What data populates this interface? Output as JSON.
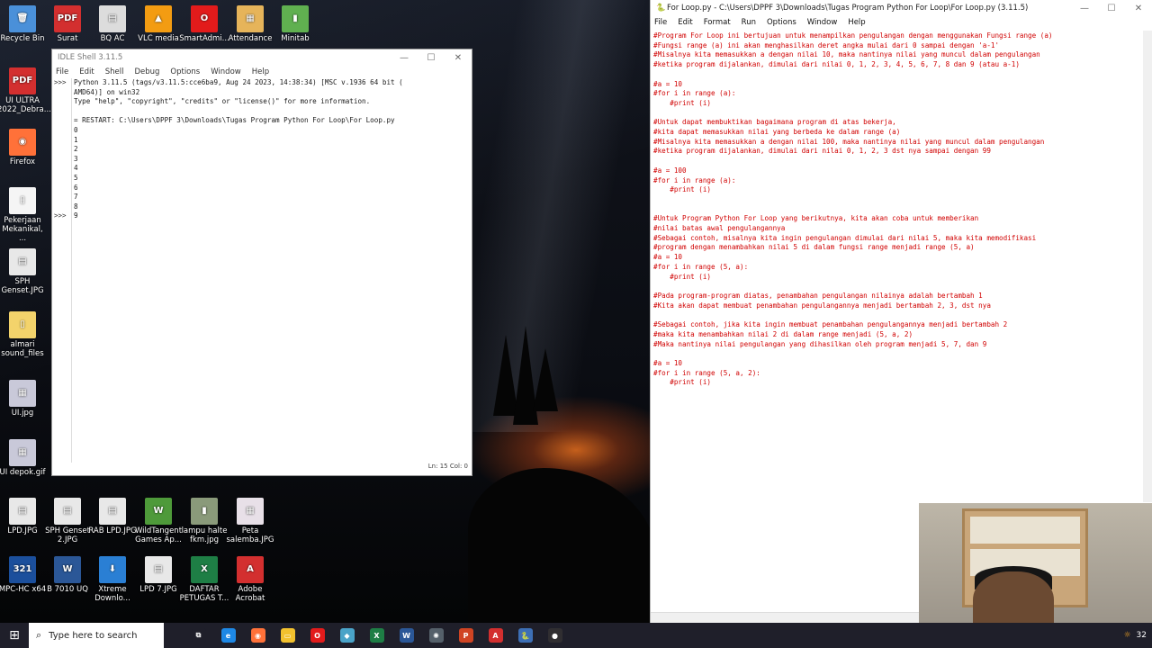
{
  "desktop": {
    "icons": [
      {
        "label": "Recycle Bin",
        "glyph": "🗑",
        "color": "#4a90d9"
      },
      {
        "label": "Surat",
        "glyph": "PDF",
        "color": "#d32f2f"
      },
      {
        "label": "BQ AC",
        "glyph": "▤",
        "color": "#dcdcdc"
      },
      {
        "label": "VLC media",
        "glyph": "▲",
        "color": "#f39c12"
      },
      {
        "label": "SmartAdmi...",
        "glyph": "O",
        "color": "#e21b1b"
      },
      {
        "label": "Attendance",
        "glyph": "▦",
        "color": "#e6b45a"
      },
      {
        "label": "Minitab",
        "glyph": "▮",
        "color": "#60b050"
      },
      {
        "label": "UI ULTRA 2022_Debra...",
        "glyph": "PDF",
        "color": "#d32f2f"
      },
      {
        "label": "Firefox",
        "glyph": "◉",
        "color": "#ff7139"
      },
      {
        "label": "Pekerjaan Mekanikal, ...",
        "glyph": "▯",
        "color": "#f5f5f5"
      },
      {
        "label": "SPH Genset.JPG",
        "glyph": "▤",
        "color": "#e8e8e8"
      },
      {
        "label": "almari sound_files",
        "glyph": "▯",
        "color": "#f3d36b"
      },
      {
        "label": "UI.jpg",
        "glyph": "▦",
        "color": "#c9c9d9"
      },
      {
        "label": "UI depok.gif",
        "glyph": "▦",
        "color": "#c9c9d9"
      },
      {
        "label": "LPD.JPG",
        "glyph": "▤",
        "color": "#e8e8e8"
      },
      {
        "label": "SPH Genset 2.JPG",
        "glyph": "▤",
        "color": "#e8e8e8"
      },
      {
        "label": "RAB LPD.JPG",
        "glyph": "▤",
        "color": "#e8e8e8"
      },
      {
        "label": "WildTangent Games Ap...",
        "glyph": "W",
        "color": "#4e9a3a"
      },
      {
        "label": "lampu halte fkm.jpg",
        "glyph": "▮",
        "color": "#8a9a7a"
      },
      {
        "label": "Peta salemba.JPG",
        "glyph": "▦",
        "color": "#e8e0e8"
      },
      {
        "label": "MPC-HC x64",
        "glyph": "321",
        "color": "#1b4f9c"
      },
      {
        "label": "B 7010 UQ",
        "glyph": "W",
        "color": "#2b5797"
      },
      {
        "label": "Xtreme Downlo...",
        "glyph": "⬇",
        "color": "#2a7fd4"
      },
      {
        "label": "LPD 7.JPG",
        "glyph": "▤",
        "color": "#e8e8e8"
      },
      {
        "label": "DAFTAR PETUGAS T...",
        "glyph": "X",
        "color": "#1e7e45"
      },
      {
        "label": "Adobe Acrobat",
        "glyph": "A",
        "color": "#d32f2f"
      }
    ]
  },
  "shell": {
    "title": "IDLE Shell 3.11.5",
    "menu": [
      "File",
      "Edit",
      "Shell",
      "Debug",
      "Options",
      "Window",
      "Help"
    ],
    "prompts": [
      ">>>",
      "",
      "",
      "",
      "",
      "",
      "",
      "",
      "",
      "",
      "",
      "",
      "",
      "",
      ">>>"
    ],
    "lines": [
      "Python 3.11.5 (tags/v3.11.5:cce6ba9, Aug 24 2023, 14:38:34) [MSC v.1936 64 bit (",
      "AMD64)] on win32",
      "Type \"help\", \"copyright\", \"credits\" or \"license()\" for more information.",
      "",
      "= RESTART: C:\\Users\\DPPF 3\\Downloads\\Tugas Program Python For Loop\\For Loop.py",
      "0",
      "1",
      "2",
      "3",
      "4",
      "5",
      "6",
      "7",
      "8",
      "9"
    ],
    "status": "Ln: 15   Col: 0"
  },
  "editor": {
    "title": "For Loop.py - C:\\Users\\DPPF 3\\Downloads\\Tugas Program Python For Loop\\For Loop.py (3.11.5)",
    "menu": [
      "File",
      "Edit",
      "Format",
      "Run",
      "Options",
      "Window",
      "Help"
    ],
    "code": [
      "#Program For Loop ini bertujuan untuk menampilkan pengulangan dengan menggunakan Fungsi range (a)",
      "#Fungsi range (a) ini akan menghasilkan deret angka mulai dari 0 sampai dengan 'a-1'",
      "#Misalnya kita memasukkan a dengan nilai 10, maka nantinya nilai yang muncul dalam pengulangan",
      "#ketika program dijalankan, dimulai dari nilai 0, 1, 2, 3, 4, 5, 6, 7, 8 dan 9 (atau a-1)",
      "",
      "#a = 10",
      "#for i in range (a):",
      "    #print (i)",
      "",
      "#Untuk dapat membuktikan bagaimana program di atas bekerja,",
      "#kita dapat memasukkan nilai yang berbeda ke dalam range (a)",
      "#Misalnya kita memasukkan a dengan nilai 100, maka nantinya nilai yang muncul dalam pengulangan",
      "#ketika program dijalankan, dimulai dari nilai 0, 1, 2, 3 dst nya sampai dengan 99",
      "",
      "#a = 100",
      "#for i in range (a):",
      "    #print (i)",
      "",
      "",
      "#Untuk Program Python For Loop yang berikutnya, kita akan coba untuk memberikan",
      "#nilai batas awal pengulangannya",
      "#Sebagai contoh, misalnya kita ingin pengulangan dimulai dari nilai 5, maka kita memodifikasi",
      "#program dengan menambahkan nilai 5 di dalam fungsi range menjadi range (5, a)",
      "#a = 10",
      "#for i in range (5, a):",
      "    #print (i)",
      "",
      "#Pada program-program diatas, penambahan pengulangan nilainya adalah bertambah 1",
      "#Kita akan dapat membuat penambahan pengulangannya menjadi bertambah 2, 3, dst nya",
      "",
      "#Sebagai contoh, jika kita ingin membuat penambahan pengulangannya menjadi bertambah 2",
      "#maka kita menambahkan nilai 2 di dalam range menjadi (5, a, 2)",
      "#Maka nantinya nilai pengulangan yang dihasilkan oleh program menjadi 5, 7, dan 9",
      "",
      "#a = 10",
      "#for i in range (5, a, 2):",
      "    #print (i)"
    ]
  },
  "taskbar": {
    "start_glyph": "⊞",
    "search_placeholder": "Type here to search",
    "apps": [
      {
        "name": "taskview",
        "glyph": "⧉",
        "color": "#1f1f2a"
      },
      {
        "name": "edge",
        "glyph": "e",
        "color": "#1e88e5"
      },
      {
        "name": "firefox",
        "glyph": "◉",
        "color": "#ff7139"
      },
      {
        "name": "explorer",
        "glyph": "▭",
        "color": "#f2c12e"
      },
      {
        "name": "opera",
        "glyph": "O",
        "color": "#e21b1b"
      },
      {
        "name": "app",
        "glyph": "◆",
        "color": "#4aa3c8"
      },
      {
        "name": "excel",
        "glyph": "X",
        "color": "#1e7e45"
      },
      {
        "name": "word",
        "glyph": "W",
        "color": "#2b5797"
      },
      {
        "name": "app2",
        "glyph": "✺",
        "color": "#55606a"
      },
      {
        "name": "powerpoint",
        "glyph": "P",
        "color": "#d04423"
      },
      {
        "name": "acrobat",
        "glyph": "A",
        "color": "#d32f2f"
      },
      {
        "name": "idle",
        "glyph": "🐍",
        "color": "#3d6fb5"
      },
      {
        "name": "obs",
        "glyph": "●",
        "color": "#302e31"
      }
    ],
    "tray_text": "32"
  }
}
